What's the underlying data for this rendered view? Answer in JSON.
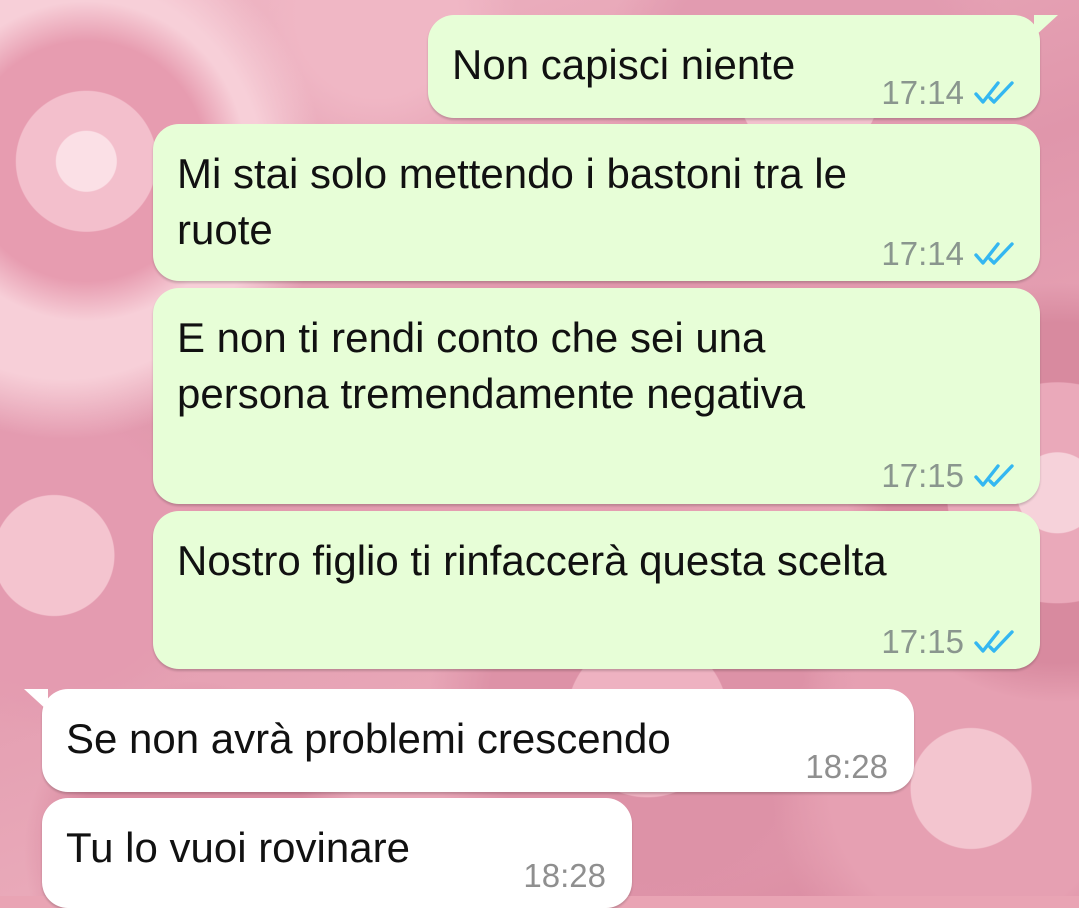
{
  "colors": {
    "outgoing_bubble": "#e7fed7",
    "incoming_bubble": "#ffffff",
    "read_ticks": "#34b7f1",
    "timestamp": "#8a968e"
  },
  "messages": [
    {
      "direction": "outgoing",
      "text": "Non capisci niente",
      "time": "17:14",
      "status_icon": "double-check-read-icon"
    },
    {
      "direction": "outgoing",
      "text": "Mi stai solo mettendo i bastoni tra le\nruote",
      "time": "17:14",
      "status_icon": "double-check-read-icon"
    },
    {
      "direction": "outgoing",
      "text": "E non ti rendi conto che sei una\npersona tremendamente negativa",
      "time": "17:15",
      "status_icon": "double-check-read-icon"
    },
    {
      "direction": "outgoing",
      "text": "Nostro figlio ti rinfaccerà questa scelta",
      "time": "17:15",
      "status_icon": "double-check-read-icon"
    },
    {
      "direction": "incoming",
      "text": "Se non avrà problemi crescendo",
      "time": "18:28"
    },
    {
      "direction": "incoming",
      "text": "Tu lo vuoi rovinare",
      "time": "18:28"
    }
  ]
}
